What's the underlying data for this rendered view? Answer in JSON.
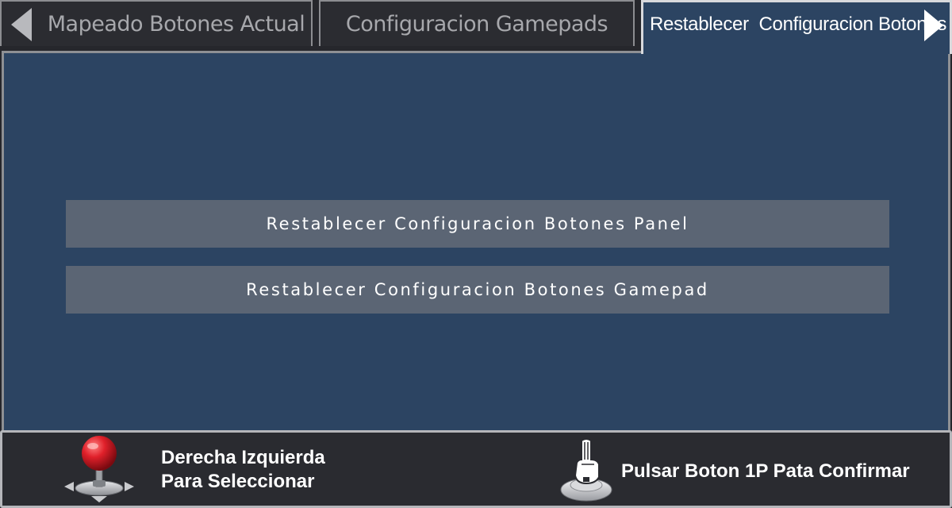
{
  "tabs": {
    "prev_label": "Mapeado Botones Actual",
    "middle_label": "Configuracion Gamepads",
    "active_label": "Restablecer  Configuracion Botones"
  },
  "options": [
    {
      "label": "Restablecer Configuracion Botones Panel"
    },
    {
      "label": "Restablecer Configuracion Botones Gamepad"
    }
  ],
  "footer": {
    "left_hint_line1": "Derecha Izquierda",
    "left_hint_line2": "Para Seleccionar",
    "right_hint": "Pulsar Boton 1P Pata Confirmar"
  },
  "icons": {
    "left": "joystick-icon",
    "right": "button-press-icon"
  },
  "colors": {
    "panel_background": "#2c4462",
    "option_background": "#5b6574",
    "tab_background": "#2b2c31",
    "text": "#ffffff",
    "inactive_text": "#a7a8ac"
  }
}
